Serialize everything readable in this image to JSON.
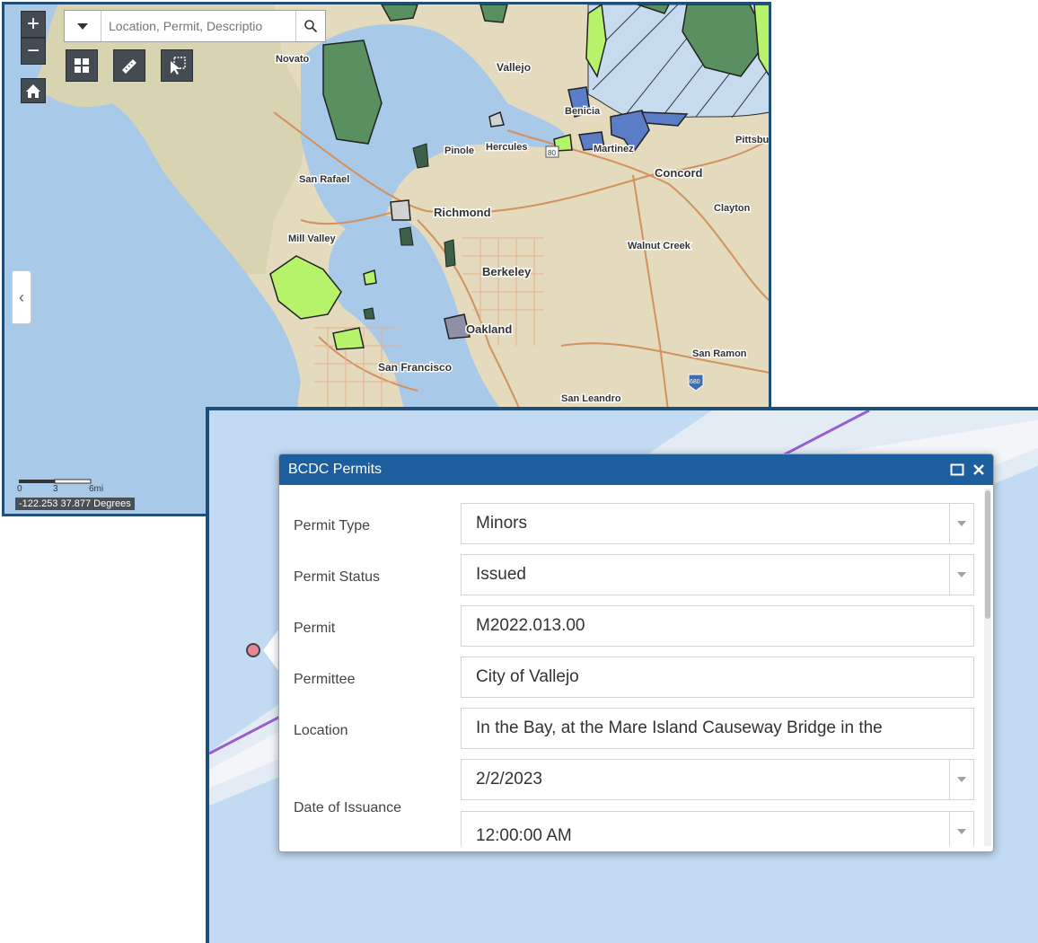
{
  "map": {
    "zoom_in_label": "+",
    "zoom_out_label": "−",
    "search": {
      "placeholder": "Location, Permit, Descriptio"
    },
    "tools": [
      "basemap-gallery-icon",
      "measure-icon",
      "select-icon"
    ],
    "scalebar": {
      "tick_0": "0",
      "tick_1": "3",
      "tick_2": "6mi"
    },
    "coordinates": "-122.253 37.877 Degrees",
    "places": {
      "novato": "Novato",
      "vallejo": "Vallejo",
      "benicia": "Benicia",
      "pinole": "Pinole",
      "hercules": "Hercules",
      "martinez": "Martinez",
      "pittsburg": "Pittsbu",
      "concord": "Concord",
      "san_rafael": "San Rafael",
      "richmond": "Richmond",
      "clayton": "Clayton",
      "mill_valley": "Mill Valley",
      "walnut_creek": "Walnut Creek",
      "berkeley": "Berkeley",
      "oakland": "Oakland",
      "san_ramon": "San Ramon",
      "san_francisco": "San Francisco",
      "san_leandro": "San Leandro",
      "route_80": "80",
      "route_680": "680"
    },
    "colors": {
      "water": "#a9c9e8",
      "land": "#e7dcc0",
      "permit_area": "#5a8f5f",
      "bright_green": "#b6f26a",
      "blue_area": "#5b7dc7",
      "road": "#d2915e"
    }
  },
  "popup": {
    "title": "BCDC Permits",
    "fields": {
      "permit_type": {
        "label": "Permit Type",
        "value": "Minors"
      },
      "permit_status": {
        "label": "Permit Status",
        "value": "Issued"
      },
      "permit": {
        "label": "Permit",
        "value": "M2022.013.00"
      },
      "permittee": {
        "label": "Permittee",
        "value": "City of Vallejo"
      },
      "location": {
        "label": "Location",
        "value": "In the Bay, at the Mare Island Causeway Bridge in the"
      },
      "date_of_issuance": {
        "label": "Date of Issuance",
        "date": "2/2/2023",
        "time": "12:00:00 AM"
      }
    },
    "colors": {
      "header": "#1d5e9f",
      "marker": "#e58694"
    }
  }
}
